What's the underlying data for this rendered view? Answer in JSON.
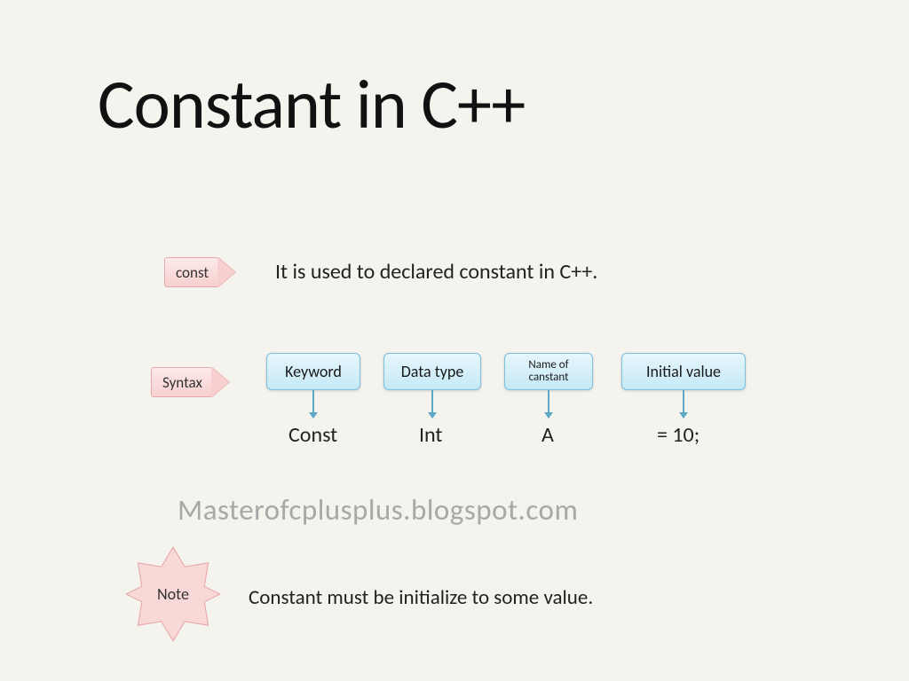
{
  "title": "Constant in C++",
  "const_tag": "const",
  "const_desc": "It is used to declared constant in C++.",
  "syntax_tag": "Syntax",
  "boxes": {
    "keyword": "Keyword",
    "datatype": "Data type",
    "nameof": "Name of canstant",
    "initial": "Initial value"
  },
  "code": {
    "keyword": "Const",
    "datatype": "Int",
    "name": "A",
    "assign": "=  10;"
  },
  "watermark": "Masterofcplusplus.blogspot.com",
  "note_tag": "Note",
  "note_text": "Constant  must be initialize  to some value."
}
